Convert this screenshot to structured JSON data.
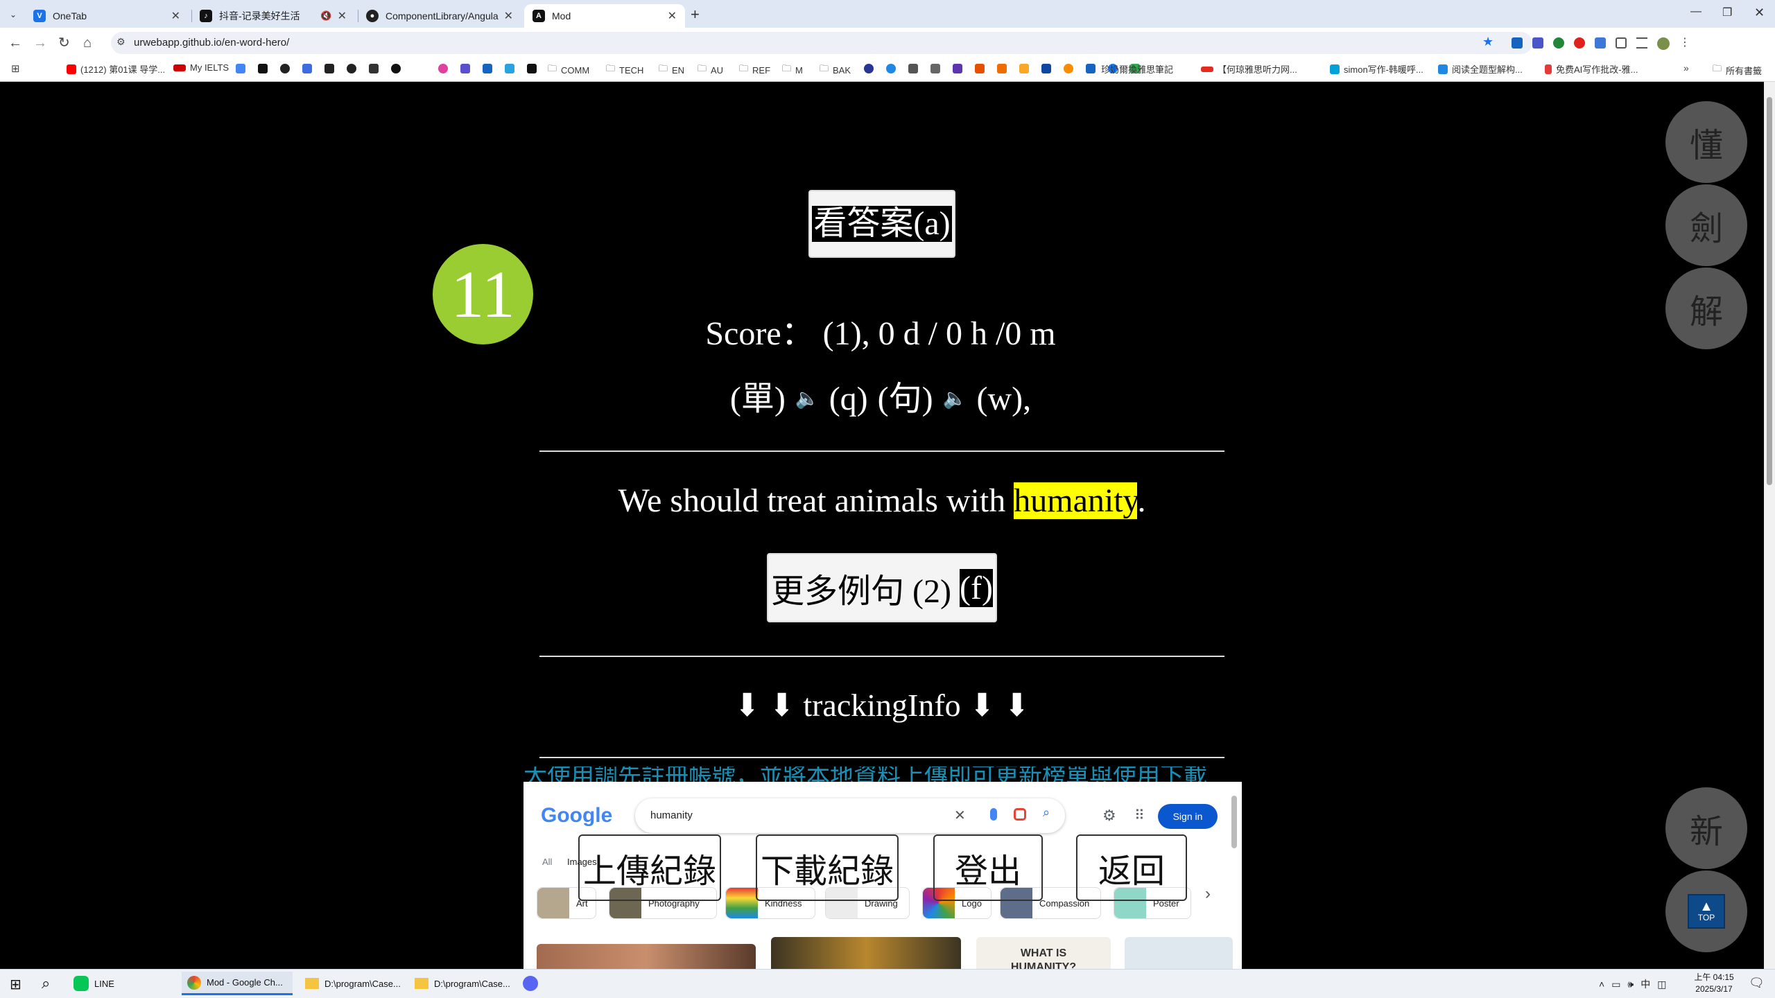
{
  "browser": {
    "tabs": [
      {
        "label": "OneTab"
      },
      {
        "label": "抖音-记录美好生活"
      },
      {
        "label": "ComponentLibrary/AngularIs"
      },
      {
        "label": "Mod"
      }
    ],
    "url": "urwebapp.github.io/en-word-hero/",
    "bookmarks": [
      {
        "label": "(1212) 第01课 导学..."
      },
      {
        "label": "My IELTS"
      },
      {
        "label": "COMM"
      },
      {
        "label": "TECH"
      },
      {
        "label": "EN"
      },
      {
        "label": "AU"
      },
      {
        "label": "REF"
      },
      {
        "label": "M"
      },
      {
        "label": "BAK"
      },
      {
        "label": "珍奶爾換雅思筆記"
      },
      {
        "label": "【何琼雅思听力网..."
      },
      {
        "label": "simon写作-韩暖呼..."
      },
      {
        "label": "阅读全题型解构..."
      },
      {
        "label": "免费AI写作批改-雅..."
      },
      {
        "label": "所有書籤"
      }
    ]
  },
  "app": {
    "counter": "11",
    "answer_button": "看答案(a)",
    "score_line": "Score： (1), 0 d / 0 h /0 m",
    "audio_line": {
      "word_label": "(單)",
      "word_key": "(q)",
      "sentence_label": "(句)",
      "sentence_key": "(w),"
    },
    "sentence": {
      "before": "We should treat animals with ",
      "highlight": "humanity",
      "after": "."
    },
    "more_examples": {
      "label": "更多例句 (2) ",
      "key": "(f)"
    },
    "tracking": "⬇ ⬇ trackingInfo ⬇ ⬇",
    "overflow_text": "大使用調先註冊帳號，並將本地資料上傳即可更新榜單與使用下載",
    "side_buttons": [
      "懂",
      "劍",
      "解"
    ],
    "new_button": "新",
    "top_button": "TOP",
    "bottom_buttons": [
      "上傳紀錄",
      "下載紀錄",
      "登出",
      "返回"
    ]
  },
  "google_embed": {
    "logo": "Google",
    "query": "humanity",
    "sign_in": "Sign in",
    "filters": [
      "All",
      "Images"
    ],
    "chips": [
      "Art",
      "Photography",
      "Kindness",
      "Drawing",
      "Logo",
      "Compassion",
      "Poster"
    ],
    "tile_text": "WHAT IS HUMANITY?"
  },
  "taskbar": {
    "apps": [
      {
        "label": "LINE"
      },
      {
        "label": "Mod - Google Ch..."
      },
      {
        "label": "D:\\program\\Case..."
      },
      {
        "label": "D:\\program\\Case..."
      }
    ],
    "time": "上午 04:15",
    "date": "2025/3/17",
    "ime": "中"
  },
  "colors": {
    "counter_bg": "#9acd32",
    "highlight": "#ffff00",
    "side_button_bg": "#555555",
    "google_signin": "#0b57d0"
  }
}
